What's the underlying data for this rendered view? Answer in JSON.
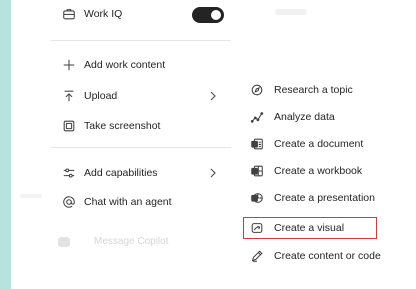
{
  "background": {
    "composer_placeholder": "Message Copilot"
  },
  "left_menu": {
    "work_iq": {
      "label": "Work IQ",
      "toggle_on": true,
      "icon": "briefcase-icon"
    },
    "items": [
      {
        "label": "Add work content",
        "icon": "plus-icon"
      },
      {
        "label": "Upload",
        "icon": "upload-icon",
        "has_submenu": true
      },
      {
        "label": "Take screenshot",
        "icon": "screenshot-icon"
      },
      {
        "label": "Add capabilities",
        "icon": "sliders-icon",
        "has_submenu": true
      },
      {
        "label": "Chat with an agent",
        "icon": "at-icon"
      }
    ]
  },
  "right_menu": {
    "items": [
      {
        "label": "Research a topic",
        "icon": "research-icon"
      },
      {
        "label": "Analyze data",
        "icon": "analyze-icon"
      },
      {
        "label": "Create a document",
        "icon": "word-icon"
      },
      {
        "label": "Create a workbook",
        "icon": "excel-icon"
      },
      {
        "label": "Create a presentation",
        "icon": "powerpoint-icon"
      },
      {
        "label": "Create a visual",
        "icon": "visual-icon",
        "highlighted": true
      },
      {
        "label": "Create content or code",
        "icon": "pen-icon"
      }
    ]
  },
  "colors": {
    "accent_highlight": "#d63a36",
    "side_strip": "#b7e3dd"
  }
}
